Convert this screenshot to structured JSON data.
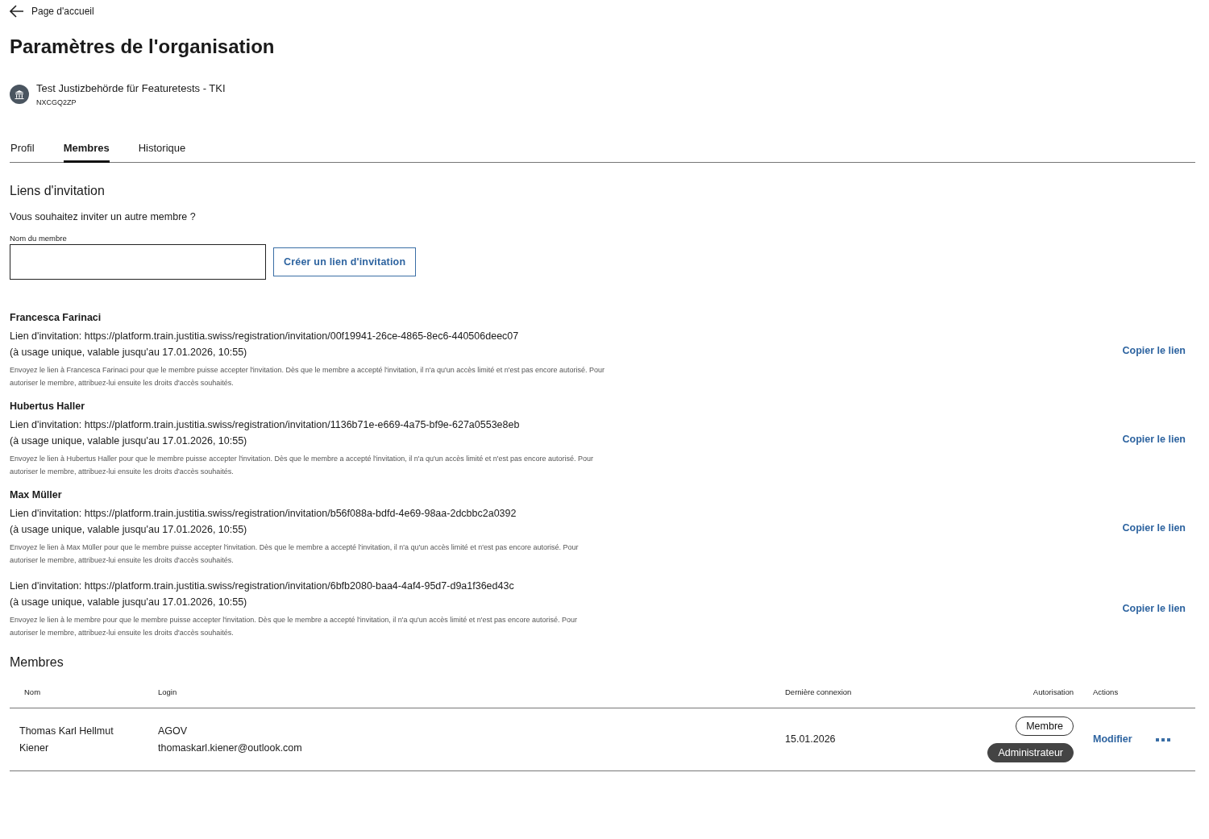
{
  "back_link": {
    "label": "Page d'accueil"
  },
  "title": "Paramètres de l'organisation",
  "organization": {
    "name": "Test Justizbehörde für Featuretests - TKI",
    "code": "NXCGQ2ZP"
  },
  "tabs": [
    {
      "label": "Profil",
      "selected": false
    },
    {
      "label": "Membres",
      "selected": true
    },
    {
      "label": "Historique",
      "selected": false
    }
  ],
  "invitations_section": {
    "heading": "Liens d'invitation",
    "prompt": "Vous souhaitez inviter un autre membre ?",
    "field_label": "Nom du membre",
    "create_button": "Créer un lien d'invitation",
    "invitations": [
      {
        "name": "Francesca Farinaci",
        "link": "Lien d'invitation: https://platform.train.justitia.swiss/registration/invitation/00f19941-26ce-4865-8ec6-440506deec07",
        "validity": "(à usage unique, valable jusqu'au 17.01.2026, 10:55)",
        "note": "Envoyez le lien à Francesca Farinaci pour que le membre puisse accepter l'invitation. Dès que le membre a accepté l'invitation, il n'a qu'un accès limité et n'est pas encore autorisé. Pour autoriser le membre, attribuez-lui ensuite les droits d'accès souhaités.",
        "copy_label": "Copier le lien"
      },
      {
        "name": "Hubertus Haller",
        "link": "Lien d'invitation: https://platform.train.justitia.swiss/registration/invitation/1136b71e-e669-4a75-bf9e-627a0553e8eb",
        "validity": "(à usage unique, valable jusqu'au 17.01.2026, 10:55)",
        "note": "Envoyez le lien à Hubertus Haller pour que le membre puisse accepter l'invitation. Dès que le membre a accepté l'invitation, il n'a qu'un accès limité et n'est pas encore autorisé. Pour autoriser le membre, attribuez-lui ensuite les droits d'accès souhaités.",
        "copy_label": "Copier le lien"
      },
      {
        "name": "Max Müller",
        "link": "Lien d'invitation: https://platform.train.justitia.swiss/registration/invitation/b56f088a-bdfd-4e69-98aa-2dcbbc2a0392",
        "validity": "(à usage unique, valable jusqu'au 17.01.2026, 10:55)",
        "note": "Envoyez le lien à Max Müller pour que le membre puisse accepter l'invitation. Dès que le membre a accepté l'invitation, il n'a qu'un accès limité et n'est pas encore autorisé. Pour autoriser le membre, attribuez-lui ensuite les droits d'accès souhaités.",
        "copy_label": "Copier le lien"
      },
      {
        "link": "Lien d'invitation: https://platform.train.justitia.swiss/registration/invitation/6bfb2080-baa4-4af4-95d7-d9a1f36ed43c",
        "validity": "(à usage unique, valable jusqu'au 17.01.2026, 10:55)",
        "note": "Envoyez le lien à le membre pour que le membre puisse accepter l'invitation. Dès que le membre a accepté l'invitation, il n'a qu'un accès limité et n'est pas encore autorisé. Pour autoriser le membre, attribuez-lui ensuite les droits d'accès souhaités.",
        "copy_label": "Copier le lien"
      }
    ]
  },
  "members_section": {
    "heading": "Membres",
    "columns": [
      "Nom",
      "Login",
      "Dernière connexion",
      "Autorisation",
      "Actions"
    ],
    "rows": [
      {
        "name": "Thomas Karl Hellmut Kiener",
        "login_provider": "AGOV",
        "login_email": "thomaskarl.kiener@outlook.com",
        "last_login": "15.01.2026",
        "roles": [
          {
            "label": "Membre",
            "kind": "outline"
          },
          {
            "label": "Administrateur",
            "kind": "filled"
          }
        ],
        "edit_label": "Modifier"
      }
    ]
  }
}
